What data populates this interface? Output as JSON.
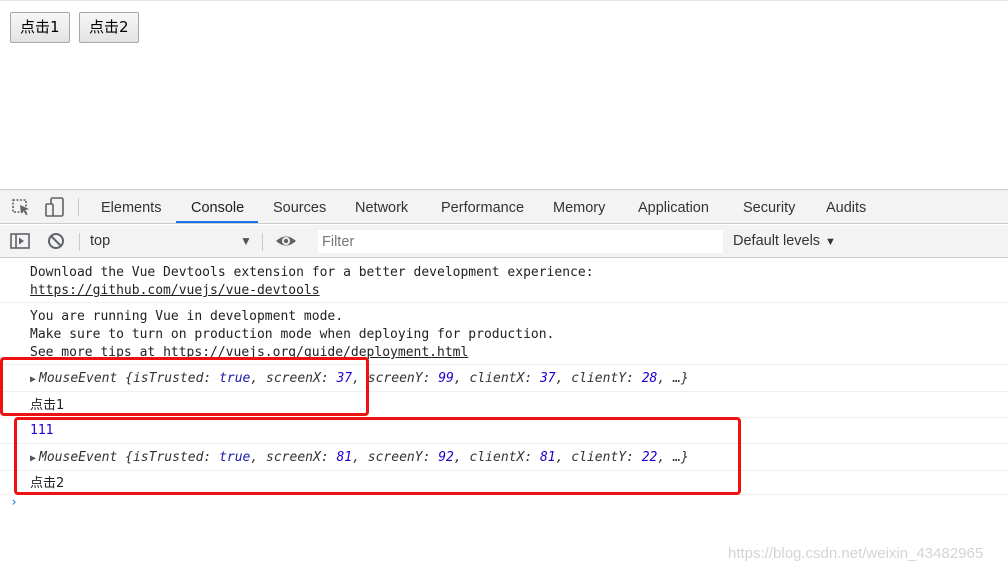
{
  "page": {
    "button1_label": "点击1",
    "button2_label": "点击2"
  },
  "devtools": {
    "toolbar_icons": [
      "inspect-element-icon",
      "device-toolbar-icon"
    ],
    "tabs": [
      "Elements",
      "Console",
      "Sources",
      "Network",
      "Performance",
      "Memory",
      "Application",
      "Security",
      "Audits"
    ],
    "active_tab": "Console",
    "console_toolbar": {
      "context": "top",
      "filter_placeholder": "Filter",
      "levels": "Default levels"
    },
    "messages": {
      "devtools_ext": "Download the Vue Devtools extension for a better development experience:",
      "devtools_link": "https://github.com/vuejs/vue-devtools",
      "dev_mode_1": "You are running Vue in development mode.",
      "dev_mode_2": "Make sure to turn on production mode when deploying for production.",
      "dev_mode_3_prefix": "See more tips at ",
      "dev_mode_3_link": "https://vuejs.org/guide/deployment.html",
      "event1": {
        "name": "MouseEvent",
        "isTrusted": "true",
        "screenX": "37",
        "screenY": "99",
        "clientX": "37",
        "clientY": "28"
      },
      "log1": "点击1",
      "log_number": "111",
      "event2": {
        "name": "MouseEvent",
        "isTrusted": "true",
        "screenX": "81",
        "screenY": "92",
        "clientX": "81",
        "clientY": "22"
      },
      "log2": "点击2"
    },
    "prompt_symbol": "›"
  },
  "colors": {
    "highlight": "#ee1111",
    "active_tab_underline": "#1a73e8",
    "keyword": "#1a1aa6",
    "number": "#1c00cf"
  },
  "watermark": "https://blog.csdn.net/weixin_43482965"
}
